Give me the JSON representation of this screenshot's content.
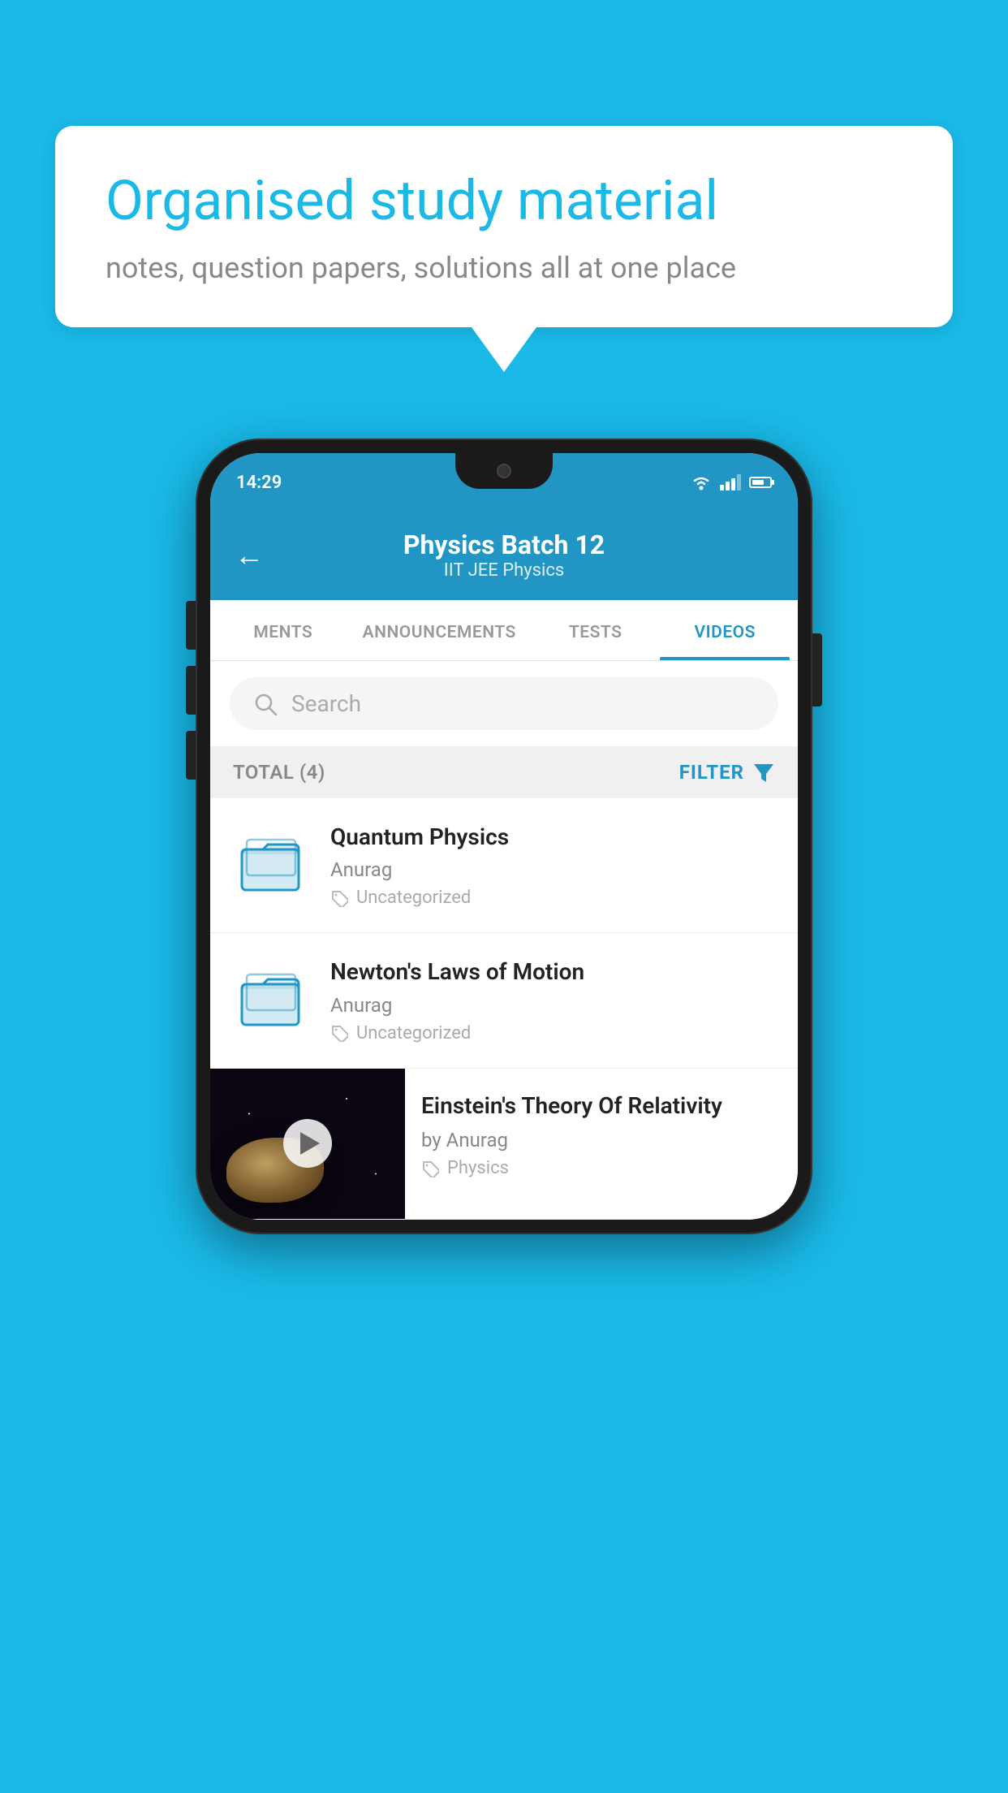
{
  "background_color": "#1ab9e8",
  "speech_bubble": {
    "title": "Organised study material",
    "subtitle": "notes, question papers, solutions all at one place"
  },
  "phone": {
    "status_bar": {
      "time": "14:29"
    },
    "header": {
      "title": "Physics Batch 12",
      "subtitle": "IIT JEE    Physics",
      "back_label": "←"
    },
    "tabs": [
      {
        "label": "MENTS",
        "active": false
      },
      {
        "label": "ANNOUNCEMENTS",
        "active": false
      },
      {
        "label": "TESTS",
        "active": false
      },
      {
        "label": "VIDEOS",
        "active": true
      }
    ],
    "search": {
      "placeholder": "Search"
    },
    "filter_row": {
      "total_label": "TOTAL (4)",
      "filter_label": "FILTER"
    },
    "videos": [
      {
        "id": 1,
        "title": "Quantum Physics",
        "author": "Anurag",
        "tag": "Uncategorized",
        "has_thumbnail": false
      },
      {
        "id": 2,
        "title": "Newton's Laws of Motion",
        "author": "Anurag",
        "tag": "Uncategorized",
        "has_thumbnail": false
      },
      {
        "id": 3,
        "title": "Einstein's Theory Of Relativity",
        "author": "by Anurag",
        "tag": "Physics",
        "has_thumbnail": true
      }
    ]
  }
}
